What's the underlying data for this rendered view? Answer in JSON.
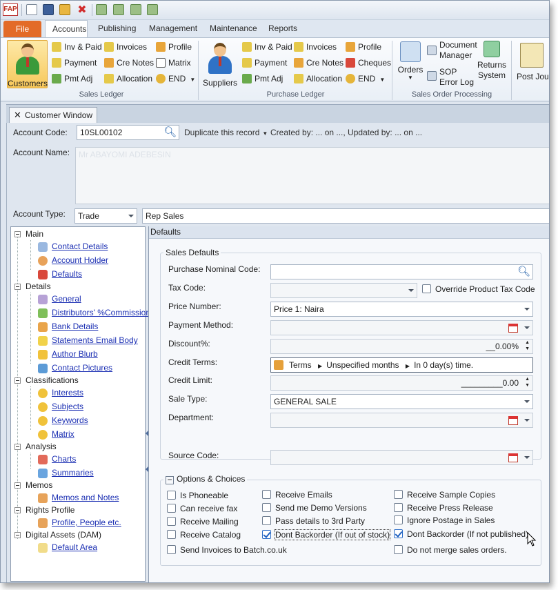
{
  "app": {
    "logo": "FAP"
  },
  "ribbon_tabs": [
    "File",
    "Accounts",
    "Publishing",
    "Management",
    "Maintenance",
    "Reports"
  ],
  "sales_ledger": {
    "big": "Customers",
    "col1": [
      "Inv & Paid",
      "Payment",
      "Pmt Adj"
    ],
    "col2": [
      "Invoices",
      "Cre Notes",
      "Allocation"
    ],
    "col3": [
      "Profile",
      "Matrix",
      "END"
    ],
    "label": "Sales Ledger"
  },
  "purchase_ledger": {
    "big": "Suppliers",
    "col1": [
      "Inv & Paid",
      "Payment",
      "Pmt Adj"
    ],
    "col2": [
      "Invoices",
      "Cre Notes",
      "Allocation"
    ],
    "col3": [
      "Profile",
      "Cheques",
      "END"
    ],
    "label": "Purchase Ledger"
  },
  "sales_order_processing": {
    "orders": "Orders",
    "doc_manager_1": "Document",
    "doc_manager_2": "Manager",
    "sop_error_1": "SOP",
    "sop_error_2": "Error Log",
    "returns_1": "Returns",
    "returns_2": "System",
    "label": "Sales Order Processing"
  },
  "post_journal": "Post Journ",
  "doc_tab": "Customer Window",
  "account": {
    "code_label": "Account Code:",
    "code_value": "10SL00102",
    "duplicate": "Duplicate this record",
    "created_updated": "Created by: ... on ..., Updated by: ... on ...",
    "name_label": "Account Name:",
    "name_value": "Mr ABAYOMI ADEBESIN",
    "type_label": "Account Type:",
    "type_value": "Trade",
    "rep_value": "Rep Sales"
  },
  "tree": {
    "main": "Main",
    "main_items": [
      "Contact Details",
      "Account Holder",
      "Defaults"
    ],
    "details": "Details",
    "details_items": [
      "General",
      "Distributors' %Commission",
      "Bank Details",
      "Statements Email Body",
      "Author Blurb",
      "Contact Pictures"
    ],
    "classifications": "Classifications",
    "class_items": [
      "Interests",
      "Subjects",
      "Keywords",
      "Matrix"
    ],
    "analysis": "Analysis",
    "analysis_items": [
      "Charts",
      "Summaries"
    ],
    "memos": "Memos",
    "memo_items": [
      "Memos and Notes"
    ],
    "rights": "Rights Profile",
    "rights_items": [
      "Profile, People etc."
    ],
    "digital": "Digital Assets (DAM)",
    "digital_items": [
      "Default Area"
    ]
  },
  "defaults": {
    "header": "Defaults",
    "group": "Sales Defaults",
    "purchase_nominal_label": "Purchase Nominal Code:",
    "tax_code_label": "Tax Code:",
    "override_tax": "Override Product Tax Code",
    "price_number_label": "Price Number:",
    "price_number_value": "Price 1: Naira",
    "payment_method_label": "Payment Method:",
    "discount_label": "Discount%:",
    "discount_value": "__0.00%",
    "credit_terms_label": "Credit Terms:",
    "terms_1": "Terms",
    "terms_2": "Unspecified months",
    "terms_3": "In 0 day(s) time.",
    "credit_limit_label": "Credit Limit:",
    "credit_limit_value": "_________0.00",
    "sale_type_label": "Sale Type:",
    "sale_type_value": "GENERAL SALE",
    "department_label": "Department:",
    "source_code_label": "Source Code:"
  },
  "options": {
    "title": "Options & Choices",
    "col1": [
      "Is Phoneable",
      "Can receive fax",
      "Receive Mailing",
      "Receive Catalog",
      "Send Invoices to Batch.co.uk"
    ],
    "col2": [
      "Receive Emails",
      "Send me Demo Versions",
      "Pass details to 3rd Party",
      "Dont Backorder (If out of stock)"
    ],
    "col3": [
      "Receive Sample Copies",
      "Receive Press Release",
      "Ignore Postage in Sales",
      "Dont Backorder (If not published)",
      "Do not merge sales orders."
    ],
    "checked": [
      "Dont Backorder (If out of stock)",
      "Dont Backorder (If not published)"
    ]
  },
  "colors": {
    "accent": "#e36b28",
    "link": "#1b2fb3",
    "selected": "#f7c85b"
  }
}
